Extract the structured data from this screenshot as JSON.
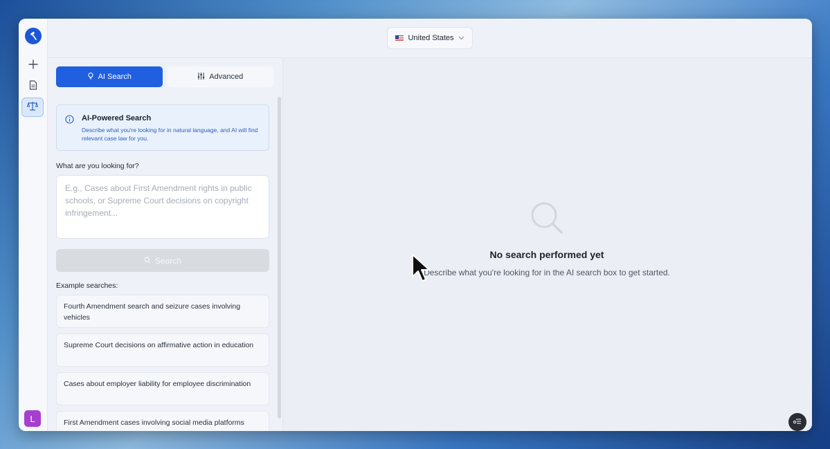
{
  "header": {
    "country": {
      "flag": "us-flag-icon",
      "label": "United States"
    }
  },
  "rail": {
    "logo": "gavel-logo-icon",
    "items": [
      {
        "name": "new",
        "icon": "plus-icon"
      },
      {
        "name": "documents",
        "icon": "document-icon"
      },
      {
        "name": "case-law",
        "icon": "scales-icon",
        "active": true
      }
    ],
    "avatar_initial": "L",
    "avatar_color": "#a63ed0"
  },
  "search_panel": {
    "tabs": [
      {
        "label": "AI Search",
        "icon": "lightbulb-icon",
        "active": true
      },
      {
        "label": "Advanced",
        "icon": "sliders-icon",
        "active": false
      }
    ],
    "info": {
      "title": "AI-Powered Search",
      "description": "Describe what you're looking for in natural language, and AI will find relevant case law for you."
    },
    "query_label": "What are you looking for?",
    "query_value": "",
    "query_placeholder": "E.g., Cases about First Amendment rights in public schools, or Supreme Court decisions on copyright infringement...",
    "search_button": "Search",
    "examples_label": "Example searches:",
    "examples": [
      "Fourth Amendment search and seizure cases involving vehicles",
      "Supreme Court decisions on affirmative action in education",
      "Cases about employer liability for employee discrimination",
      "First Amendment cases involving social media platforms"
    ]
  },
  "results": {
    "empty_title": "No search performed yet",
    "empty_description": "Describe what you're looking for in the AI search box to get started."
  },
  "colors": {
    "accent": "#1f5fe0",
    "info_bg": "#e9f1fd",
    "info_text": "#2d5fb8",
    "disabled_button": "#d8dbe0"
  }
}
